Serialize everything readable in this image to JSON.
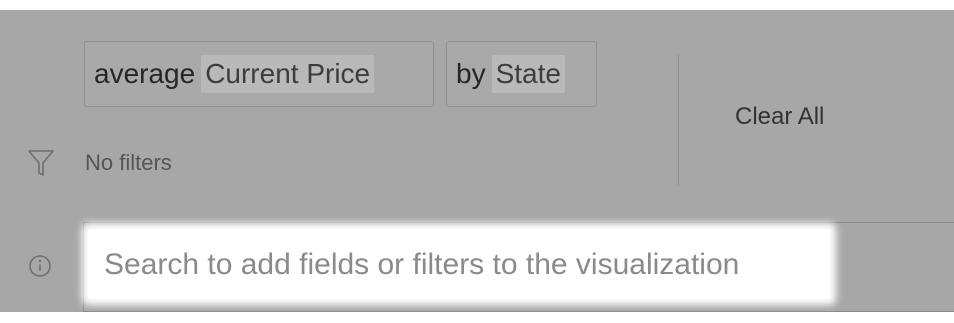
{
  "query_pills": [
    {
      "word": "average",
      "field": "Current Price"
    },
    {
      "word": "by",
      "field": "State"
    }
  ],
  "clear_all_label": "Clear All",
  "filters": {
    "icon": "filter-icon",
    "status_text": "No filters"
  },
  "search": {
    "icon": "info-icon",
    "placeholder": "Search to add fields or filters to the visualization",
    "value": ""
  },
  "colors": {
    "panel_background": "#a7a7a7",
    "field_highlight": "#b9b9b9",
    "search_highlight": "#ffffff"
  }
}
